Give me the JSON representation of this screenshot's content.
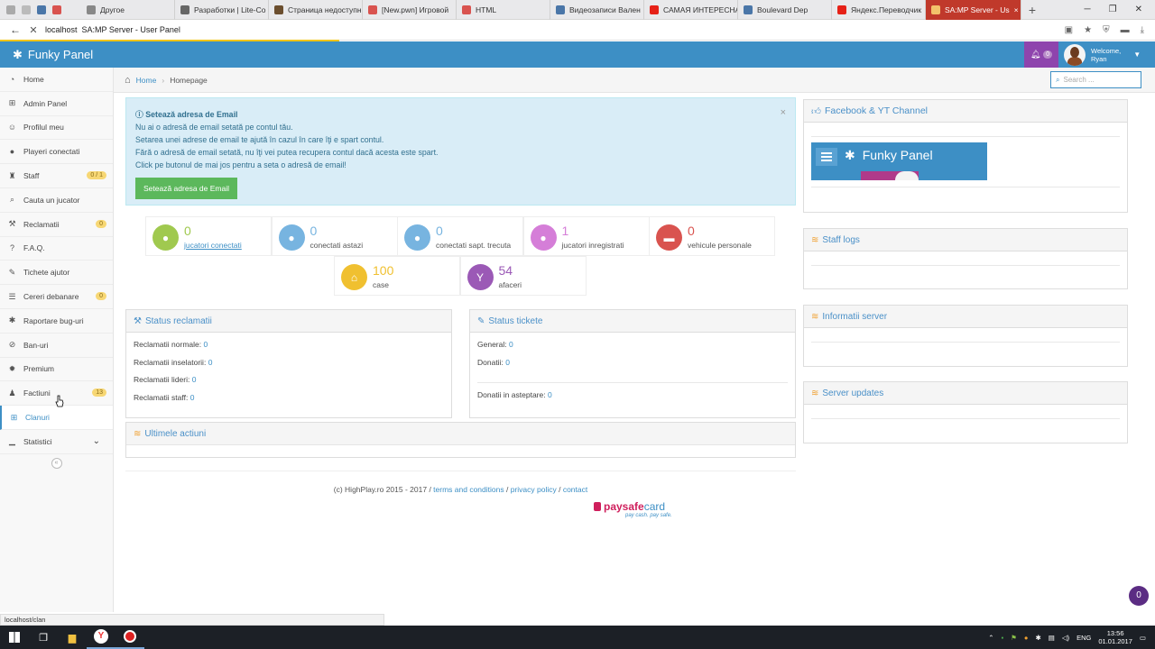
{
  "browser": {
    "tabs": [
      {
        "title": "Другое",
        "color": "#888888"
      },
      {
        "title": "Разработки | Lite-Co",
        "color": "#666666"
      },
      {
        "title": "Страница недоступна",
        "color": "#6b4e2e"
      },
      {
        "title": "[New.pwn] Игровой",
        "color": "#d9534f"
      },
      {
        "title": "HTML",
        "color": "#d9534f"
      },
      {
        "title": "Видеозаписи Вален",
        "color": "#4a76a8"
      },
      {
        "title": "САМАЯ ИНТЕРЕСНА",
        "color": "#e62117"
      },
      {
        "title": "Boulevard Dep",
        "color": "#4a76a8"
      },
      {
        "title": "Яндекс.Переводчик",
        "color": "#e62117"
      }
    ],
    "active_tab": "SA:MP Server - Us",
    "url_host": "localhost",
    "url_title": "SA:MP Server - User Panel",
    "status_url": "localhost/clan"
  },
  "topnav": {
    "brand": "Funky Panel",
    "notif_count": "0",
    "welcome": "Welcome,",
    "user": "Ryan"
  },
  "sidebar": {
    "items": [
      {
        "label": "Home",
        "icon": "dashboard-icon",
        "glyph": "◔",
        "badge": ""
      },
      {
        "label": "Admin Panel",
        "icon": "sitemap-icon",
        "glyph": "⊞",
        "badge": ""
      },
      {
        "label": "Profilul meu",
        "icon": "smile-icon",
        "glyph": "☺",
        "badge": ""
      },
      {
        "label": "Playeri conectati",
        "icon": "user-icon",
        "glyph": "●",
        "badge": ""
      },
      {
        "label": "Staff",
        "icon": "android-icon",
        "glyph": "♜",
        "badge": "0 / 1"
      },
      {
        "label": "Cauta un jucator",
        "icon": "search-icon",
        "glyph": "⌕",
        "badge": ""
      },
      {
        "label": "Reclamatii",
        "icon": "gavel-icon",
        "glyph": "⚒",
        "badge": "0"
      },
      {
        "label": "F.A.Q.",
        "icon": "question-icon",
        "glyph": "?",
        "badge": ""
      },
      {
        "label": "Tichete ajutor",
        "icon": "ticket-icon",
        "glyph": "✎",
        "badge": ""
      },
      {
        "label": "Cereri debanare",
        "icon": "list-icon",
        "glyph": "☰",
        "badge": "0"
      },
      {
        "label": "Raportare bug-uri",
        "icon": "bug-icon",
        "glyph": "✱",
        "badge": ""
      },
      {
        "label": "Ban-uri",
        "icon": "ban-icon",
        "glyph": "⊘",
        "badge": ""
      },
      {
        "label": "Premium",
        "icon": "certificate-icon",
        "glyph": "✹",
        "badge": ""
      },
      {
        "label": "Factiuni",
        "icon": "users-icon",
        "glyph": "♟",
        "badge": "13"
      },
      {
        "label": "Clanuri",
        "icon": "sitemap-icon",
        "glyph": "⊞",
        "badge": ""
      },
      {
        "label": "Statistici",
        "icon": "signal-icon",
        "glyph": "▁",
        "badge": ""
      }
    ],
    "collapse_glyph": "«"
  },
  "breadcrumb": {
    "home": "Home",
    "sep": "›",
    "current": "Homepage"
  },
  "search": {
    "placeholder": "Search ..."
  },
  "alert": {
    "title": "Setează adresa de Email",
    "lines": [
      "Nu ai o adresă de email setată pe contul tău.",
      "Setarea unei adrese de email te ajută în cazul în care îţi e spart contul.",
      "Fără o adresă de email setată, nu îţi vei putea recupera contul dacă acesta este spart.",
      "Click pe butonul de mai jos pentru a seta o adresă de email!"
    ],
    "button": "Setează adresa de Email",
    "close": "×"
  },
  "stats": [
    {
      "value": "0",
      "label": "jucatori conectati",
      "color": "#a0c94f",
      "glyph": "●",
      "icon": "user-icon",
      "link": true
    },
    {
      "value": "0",
      "label": "conectati astazi",
      "color": "#77b4e0",
      "glyph": "●",
      "icon": "user-icon",
      "link": false
    },
    {
      "value": "0",
      "label": "conectati sapt. trecuta",
      "color": "#77b4e0",
      "glyph": "●",
      "icon": "user-icon",
      "link": false
    },
    {
      "value": "1",
      "label": "jucatori inregistrati",
      "color": "#d57ed8",
      "glyph": "●",
      "icon": "user-icon",
      "link": false
    },
    {
      "value": "0",
      "label": "vehicule personale",
      "color": "#d9534f",
      "glyph": "▬",
      "icon": "truck-icon",
      "link": false
    },
    {
      "value": "100",
      "label": "case",
      "color": "#f0c030",
      "glyph": "⌂",
      "icon": "home-icon",
      "link": false
    },
    {
      "value": "54",
      "label": "afaceri",
      "color": "#9b59b6",
      "glyph": "Y",
      "icon": "glass-icon",
      "link": false
    }
  ],
  "status_reclamatii": {
    "title": "Status reclamatii",
    "rows": [
      {
        "label": "Reclamatii normale:",
        "value": "0"
      },
      {
        "label": "Reclamatii inselatorii:",
        "value": "0"
      },
      {
        "label": "Reclamatii lideri:",
        "value": "0"
      },
      {
        "label": "Reclamatii staff:",
        "value": "0"
      }
    ]
  },
  "status_tickete": {
    "title": "Status tickete",
    "rows": [
      {
        "label": "General:",
        "value": "0"
      },
      {
        "label": "Donatii:",
        "value": "0"
      }
    ],
    "waiting_label": "Donatii in asteptare:",
    "waiting_value": "0"
  },
  "ultimele": {
    "title": "Ultimele actiuni"
  },
  "right_panels": {
    "facebook": "Facebook & YT Channel",
    "banner": "Funky Panel",
    "staff_logs": "Staff logs",
    "info": "Informatii server",
    "updates": "Server updates"
  },
  "footer": {
    "copy": "(c) HighPlay.ro 2015 - 2017 / ",
    "terms": "terms and conditions",
    "slash1": " / ",
    "privacy": "privacy policy",
    "slash2": " / ",
    "contact": "contact",
    "psc_a": "paysafe",
    "psc_b": "card",
    "psc_tag": "pay cash. pay safe."
  },
  "chat_count": "0",
  "taskbar": {
    "lang": "ENG",
    "time": "13:56",
    "date": "01.01.2017"
  }
}
